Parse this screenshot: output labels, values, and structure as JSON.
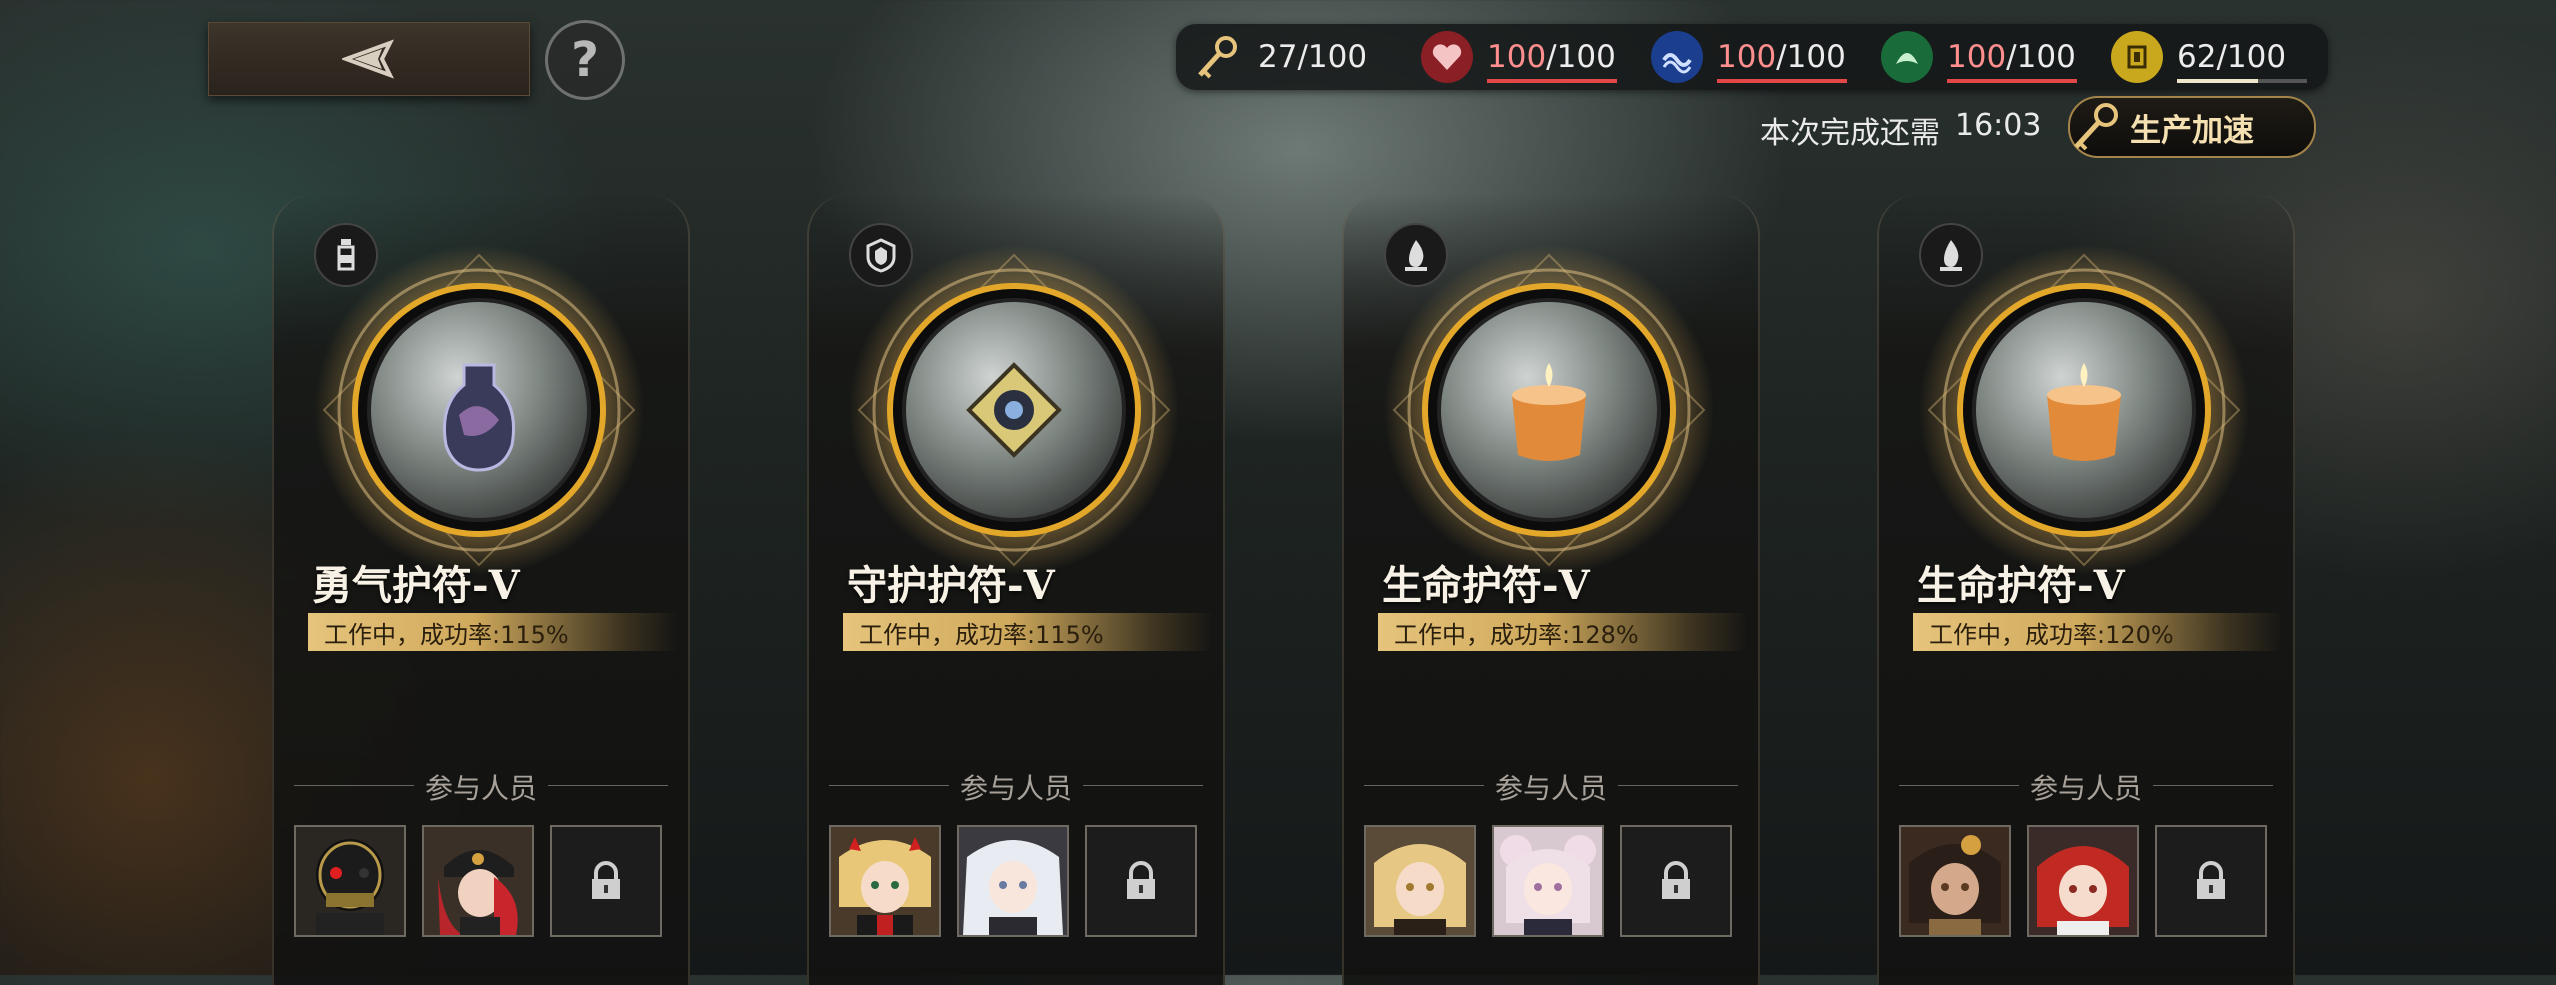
{
  "resources": [
    {
      "icon": "key-icon",
      "value": "27/100"
    },
    {
      "icon": "red-heart-icon",
      "current": "100",
      "max": "/100",
      "fill": 1.0
    },
    {
      "icon": "blue-wave-icon",
      "current": "100",
      "max": "/100",
      "fill": 1.0
    },
    {
      "icon": "green-leaf-icon",
      "current": "100",
      "max": "/100",
      "fill": 1.0
    },
    {
      "icon": "yellow-block-icon",
      "current": "62",
      "max": "/100",
      "fill": 0.62
    }
  ],
  "finish": {
    "label": "本次完成还需",
    "time": "16:03"
  },
  "speed_button": "生产加速",
  "participants_label": "参与人员",
  "cards": [
    {
      "type_icon": "bottle-icon",
      "title": "勇气护符-Ⅴ",
      "status": "工作中，成功率:115%",
      "orb": "bottle"
    },
    {
      "type_icon": "shield-icon",
      "title": "守护护符-Ⅴ",
      "status": "工作中，成功率:115%",
      "orb": "shield"
    },
    {
      "type_icon": "flame-icon",
      "title": "生命护符-Ⅴ",
      "status": "工作中，成功率:128%",
      "orb": "candle"
    },
    {
      "type_icon": "flame-icon",
      "title": "生命护符-Ⅴ",
      "status": "工作中，成功率:120%",
      "orb": "candle"
    }
  ],
  "colors": {
    "accent_gold": "#e6c47c",
    "bar_red": "#e24848"
  }
}
